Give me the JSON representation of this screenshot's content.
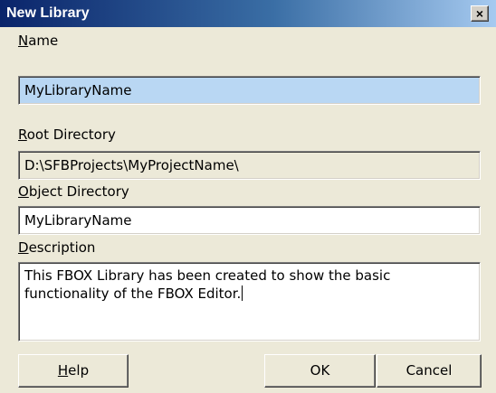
{
  "window": {
    "title": "New Library",
    "close_label": "×"
  },
  "form": {
    "name_label_key": "N",
    "name_label_rest": "ame",
    "name_value": "MyLibraryName",
    "root_label_key": "R",
    "root_label_rest": "oot Directory",
    "root_value": "D:\\SFBProjects\\MyProjectName\\",
    "object_label_key": "O",
    "object_label_rest": "bject Directory",
    "object_value": "MyLibraryName",
    "description_label_key": "D",
    "description_label_rest": "escription",
    "description_value": "This FBOX Library has been created to show the basic\nfunctionality of the FBOX Editor."
  },
  "buttons": {
    "help_key": "H",
    "help_rest": "elp",
    "ok_label": "OK",
    "cancel_label": "Cancel"
  },
  "colors": {
    "title_bar_start": "#0a246a",
    "title_bar_end": "#a6caf0",
    "dialog_background": "#ece9d8",
    "selection_highlight": "#b9d7f3"
  },
  "icons": {
    "close": "close-icon"
  }
}
